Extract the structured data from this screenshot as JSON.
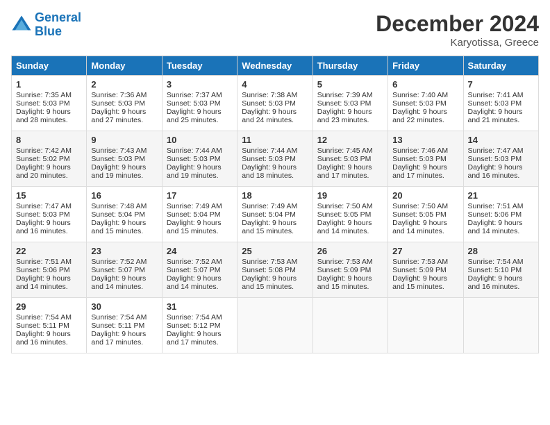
{
  "logo": {
    "line1": "General",
    "line2": "Blue"
  },
  "title": "December 2024",
  "location": "Karyotissa, Greece",
  "headers": [
    "Sunday",
    "Monday",
    "Tuesday",
    "Wednesday",
    "Thursday",
    "Friday",
    "Saturday"
  ],
  "weeks": [
    [
      {
        "day": "1",
        "sunrise": "7:35 AM",
        "sunset": "5:03 PM",
        "daylight": "9 hours and 28 minutes."
      },
      {
        "day": "2",
        "sunrise": "7:36 AM",
        "sunset": "5:03 PM",
        "daylight": "9 hours and 27 minutes."
      },
      {
        "day": "3",
        "sunrise": "7:37 AM",
        "sunset": "5:03 PM",
        "daylight": "9 hours and 25 minutes."
      },
      {
        "day": "4",
        "sunrise": "7:38 AM",
        "sunset": "5:03 PM",
        "daylight": "9 hours and 24 minutes."
      },
      {
        "day": "5",
        "sunrise": "7:39 AM",
        "sunset": "5:03 PM",
        "daylight": "9 hours and 23 minutes."
      },
      {
        "day": "6",
        "sunrise": "7:40 AM",
        "sunset": "5:03 PM",
        "daylight": "9 hours and 22 minutes."
      },
      {
        "day": "7",
        "sunrise": "7:41 AM",
        "sunset": "5:03 PM",
        "daylight": "9 hours and 21 minutes."
      }
    ],
    [
      {
        "day": "8",
        "sunrise": "7:42 AM",
        "sunset": "5:02 PM",
        "daylight": "9 hours and 20 minutes."
      },
      {
        "day": "9",
        "sunrise": "7:43 AM",
        "sunset": "5:03 PM",
        "daylight": "9 hours and 19 minutes."
      },
      {
        "day": "10",
        "sunrise": "7:44 AM",
        "sunset": "5:03 PM",
        "daylight": "9 hours and 19 minutes."
      },
      {
        "day": "11",
        "sunrise": "7:44 AM",
        "sunset": "5:03 PM",
        "daylight": "9 hours and 18 minutes."
      },
      {
        "day": "12",
        "sunrise": "7:45 AM",
        "sunset": "5:03 PM",
        "daylight": "9 hours and 17 minutes."
      },
      {
        "day": "13",
        "sunrise": "7:46 AM",
        "sunset": "5:03 PM",
        "daylight": "9 hours and 17 minutes."
      },
      {
        "day": "14",
        "sunrise": "7:47 AM",
        "sunset": "5:03 PM",
        "daylight": "9 hours and 16 minutes."
      }
    ],
    [
      {
        "day": "15",
        "sunrise": "7:47 AM",
        "sunset": "5:03 PM",
        "daylight": "9 hours and 16 minutes."
      },
      {
        "day": "16",
        "sunrise": "7:48 AM",
        "sunset": "5:04 PM",
        "daylight": "9 hours and 15 minutes."
      },
      {
        "day": "17",
        "sunrise": "7:49 AM",
        "sunset": "5:04 PM",
        "daylight": "9 hours and 15 minutes."
      },
      {
        "day": "18",
        "sunrise": "7:49 AM",
        "sunset": "5:04 PM",
        "daylight": "9 hours and 15 minutes."
      },
      {
        "day": "19",
        "sunrise": "7:50 AM",
        "sunset": "5:05 PM",
        "daylight": "9 hours and 14 minutes."
      },
      {
        "day": "20",
        "sunrise": "7:50 AM",
        "sunset": "5:05 PM",
        "daylight": "9 hours and 14 minutes."
      },
      {
        "day": "21",
        "sunrise": "7:51 AM",
        "sunset": "5:06 PM",
        "daylight": "9 hours and 14 minutes."
      }
    ],
    [
      {
        "day": "22",
        "sunrise": "7:51 AM",
        "sunset": "5:06 PM",
        "daylight": "9 hours and 14 minutes."
      },
      {
        "day": "23",
        "sunrise": "7:52 AM",
        "sunset": "5:07 PM",
        "daylight": "9 hours and 14 minutes."
      },
      {
        "day": "24",
        "sunrise": "7:52 AM",
        "sunset": "5:07 PM",
        "daylight": "9 hours and 14 minutes."
      },
      {
        "day": "25",
        "sunrise": "7:53 AM",
        "sunset": "5:08 PM",
        "daylight": "9 hours and 15 minutes."
      },
      {
        "day": "26",
        "sunrise": "7:53 AM",
        "sunset": "5:09 PM",
        "daylight": "9 hours and 15 minutes."
      },
      {
        "day": "27",
        "sunrise": "7:53 AM",
        "sunset": "5:09 PM",
        "daylight": "9 hours and 15 minutes."
      },
      {
        "day": "28",
        "sunrise": "7:54 AM",
        "sunset": "5:10 PM",
        "daylight": "9 hours and 16 minutes."
      }
    ],
    [
      {
        "day": "29",
        "sunrise": "7:54 AM",
        "sunset": "5:11 PM",
        "daylight": "9 hours and 16 minutes."
      },
      {
        "day": "30",
        "sunrise": "7:54 AM",
        "sunset": "5:11 PM",
        "daylight": "9 hours and 17 minutes."
      },
      {
        "day": "31",
        "sunrise": "7:54 AM",
        "sunset": "5:12 PM",
        "daylight": "9 hours and 17 minutes."
      },
      null,
      null,
      null,
      null
    ]
  ],
  "labels": {
    "sunrise": "Sunrise:",
    "sunset": "Sunset:",
    "daylight": "Daylight:"
  }
}
